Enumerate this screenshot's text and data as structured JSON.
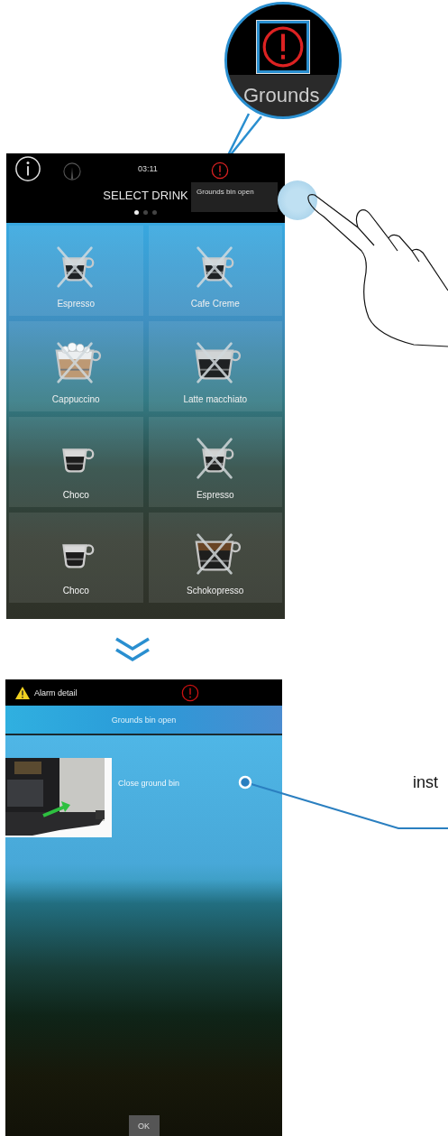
{
  "magnifier": {
    "label": "Grounds"
  },
  "drink_screen": {
    "time": "03:11",
    "title": "SELECT DRINK",
    "tooltip": "Grounds bin open",
    "pages": [
      {
        "selected": true
      },
      {
        "selected": false
      },
      {
        "selected": false
      }
    ],
    "drinks": [
      {
        "name": "Espresso",
        "kind": "small",
        "disabled": true
      },
      {
        "name": "Cafe Creme",
        "kind": "small",
        "disabled": true
      },
      {
        "name": "Cappuccino",
        "kind": "foam",
        "disabled": true
      },
      {
        "name": "Latte macchiato",
        "kind": "large",
        "disabled": true
      },
      {
        "name": "Choco",
        "kind": "small",
        "disabled": false
      },
      {
        "name": "Espresso",
        "kind": "small",
        "disabled": true
      },
      {
        "name": "Choco",
        "kind": "small",
        "disabled": false
      },
      {
        "name": "Schokopresso",
        "kind": "mocha",
        "disabled": true
      }
    ]
  },
  "alarm_screen": {
    "title": "Alarm detail",
    "message": "Grounds bin open",
    "instruction": "Close ground bin",
    "button": "OK"
  },
  "callout": {
    "label": "inst"
  }
}
